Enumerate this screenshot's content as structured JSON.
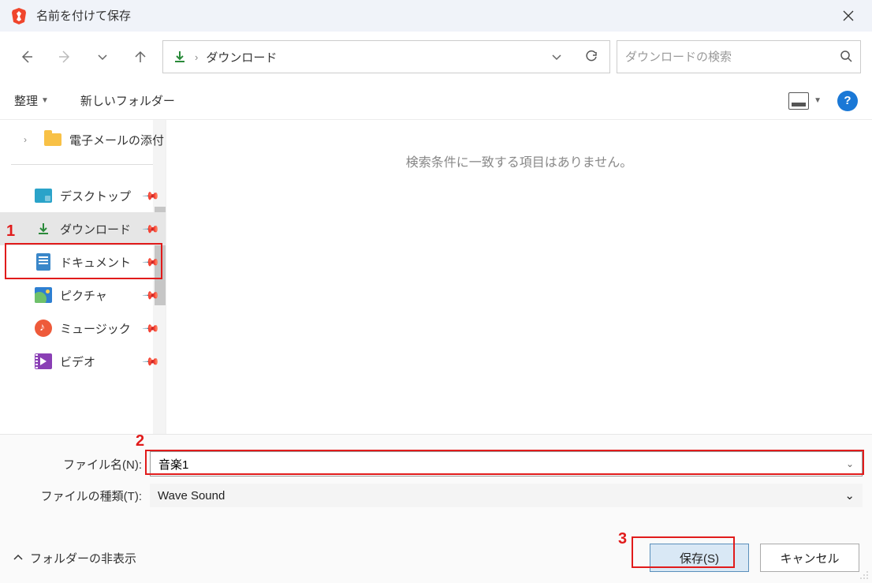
{
  "window": {
    "title": "名前を付けて保存"
  },
  "path": {
    "current": "ダウンロード"
  },
  "search": {
    "placeholder": "ダウンロードの検索"
  },
  "toolbar": {
    "organize": "整理",
    "new_folder": "新しいフォルダー"
  },
  "tree": {
    "group1": [
      {
        "label": "電子メールの添付"
      }
    ],
    "quick": [
      {
        "label": "デスクトップ",
        "icon": "desktop"
      },
      {
        "label": "ダウンロード",
        "icon": "download",
        "selected": true
      },
      {
        "label": "ドキュメント",
        "icon": "doc"
      },
      {
        "label": "ピクチャ",
        "icon": "pic"
      },
      {
        "label": "ミュージック",
        "icon": "music"
      },
      {
        "label": "ビデオ",
        "icon": "video"
      }
    ]
  },
  "main": {
    "empty_message": "検索条件に一致する項目はありません。"
  },
  "form": {
    "filename_label": "ファイル名(N):",
    "filename_value": "音楽1",
    "filetype_label": "ファイルの種類(T):",
    "filetype_value": "Wave Sound"
  },
  "footer": {
    "hide_folders": "フォルダーの非表示",
    "save": "保存(S)",
    "cancel": "キャンセル"
  },
  "annotations": {
    "a1": "1",
    "a2": "2",
    "a3": "3"
  }
}
